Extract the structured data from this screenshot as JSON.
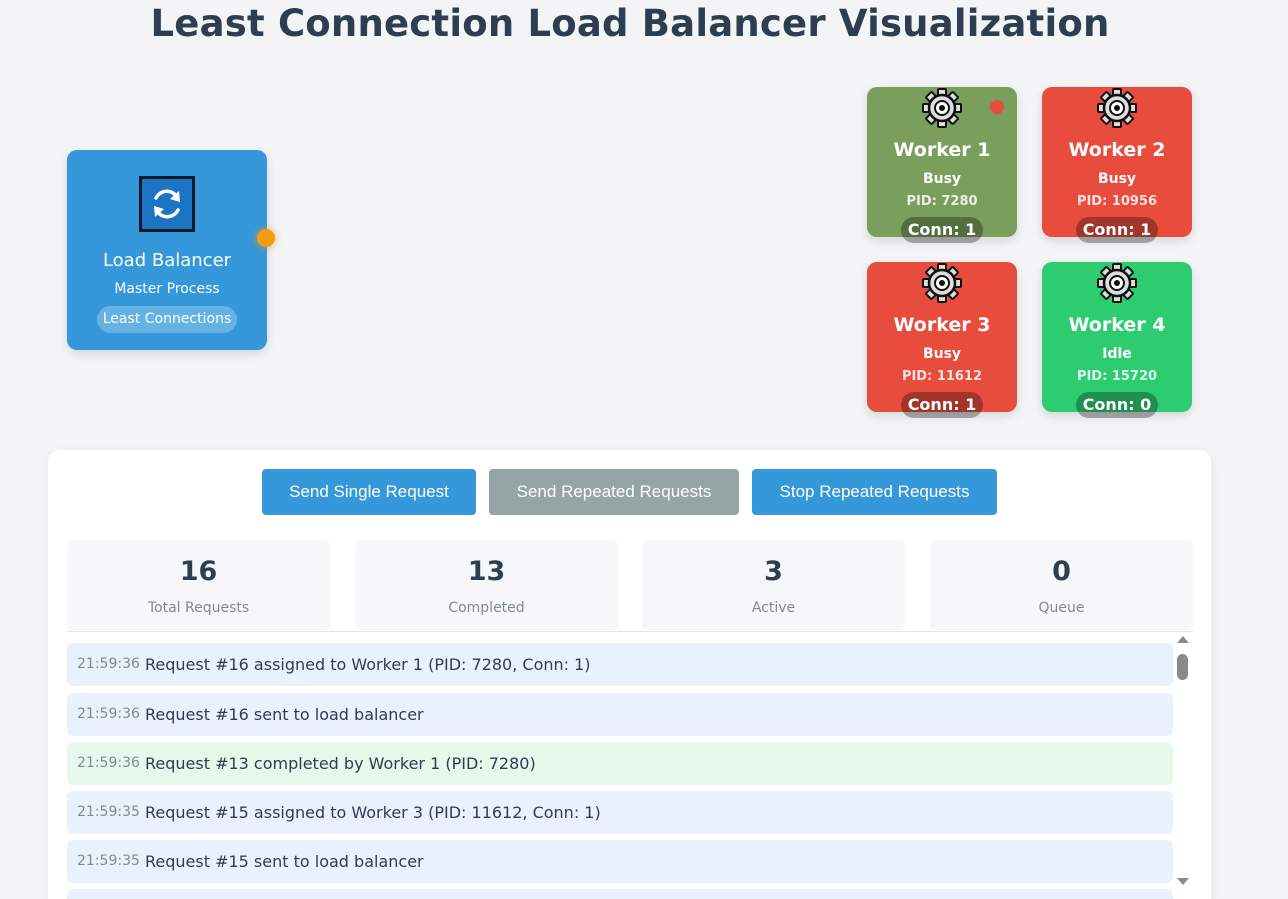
{
  "title": "Least Connection Load Balancer Visualization",
  "load_balancer": {
    "title": "Load Balancer",
    "subtitle": "Master Process",
    "algorithm": "Least Connections",
    "icon": "refresh-icon",
    "color": "#3498db"
  },
  "workers": [
    {
      "name": "Worker 1",
      "status": "Busy",
      "pid": "PID: 7280",
      "conn": "Conn: 1",
      "color": "#7a9e5c",
      "receiving": true
    },
    {
      "name": "Worker 2",
      "status": "Busy",
      "pid": "PID: 10956",
      "conn": "Conn: 1",
      "color": "#e74c3c",
      "receiving": false
    },
    {
      "name": "Worker 3",
      "status": "Busy",
      "pid": "PID: 11612",
      "conn": "Conn: 1",
      "color": "#e74c3c",
      "receiving": false
    },
    {
      "name": "Worker 4",
      "status": "Idle",
      "pid": "PID: 15720",
      "conn": "Conn: 0",
      "color": "#2ecc71",
      "receiving": false
    }
  ],
  "controls": {
    "send_single": "Send Single Request",
    "send_repeated": "Send Repeated Requests",
    "stop_repeated": "Stop Repeated Requests"
  },
  "stats": [
    {
      "value": "16",
      "label": "Total Requests"
    },
    {
      "value": "13",
      "label": "Completed"
    },
    {
      "value": "3",
      "label": "Active"
    },
    {
      "value": "0",
      "label": "Queue"
    }
  ],
  "log": [
    {
      "time": "21:59:36",
      "message": "Request #16 assigned to Worker 1 (PID: 7280, Conn: 1)",
      "type": "info"
    },
    {
      "time": "21:59:36",
      "message": "Request #16 sent to load balancer",
      "type": "info"
    },
    {
      "time": "21:59:36",
      "message": "Request #13 completed by Worker 1 (PID: 7280)",
      "type": "success"
    },
    {
      "time": "21:59:35",
      "message": "Request #15 assigned to Worker 3 (PID: 11612, Conn: 1)",
      "type": "info"
    },
    {
      "time": "21:59:35",
      "message": "Request #15 sent to load balancer",
      "type": "info"
    }
  ]
}
